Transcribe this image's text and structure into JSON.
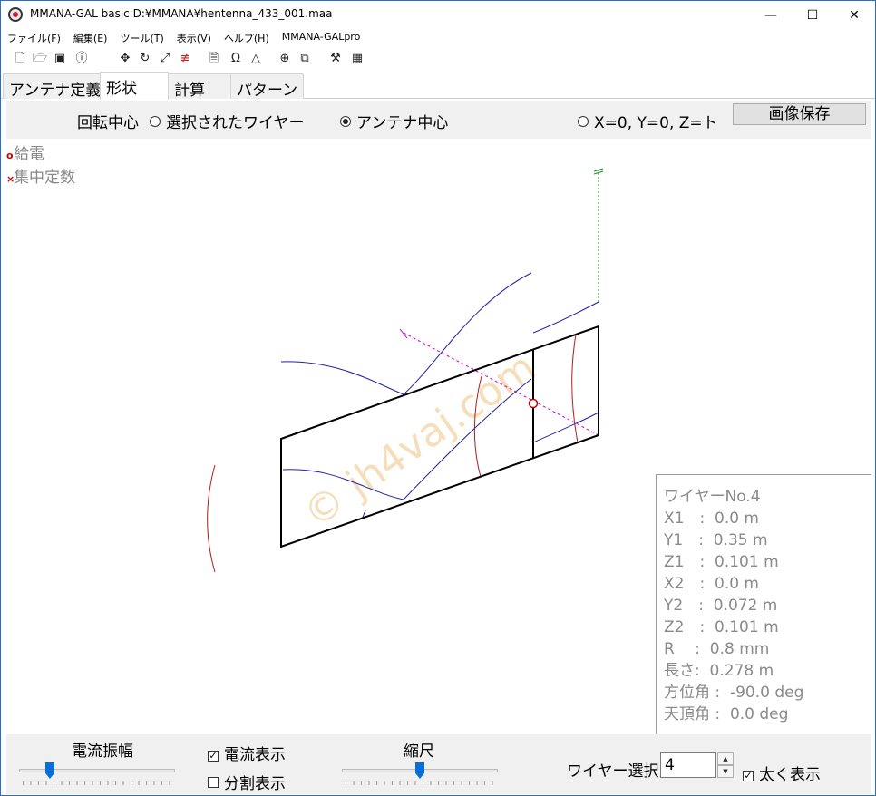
{
  "window": {
    "title": "MMANA-GAL basic  D:¥MMANA¥hentenna_433_001.maa",
    "controls": {
      "minimize": "—",
      "maximize": "☐",
      "close": "✕"
    }
  },
  "menu": [
    "ファイル(F)",
    "編集(E)",
    "ツール(T)",
    "表示(V)",
    "ヘルプ(H)",
    "MMANA-GALpro"
  ],
  "toolbar_icons": [
    "new-file-icon",
    "open-folder-icon",
    "save-icon",
    "info-icon",
    "move-icon",
    "rotate-icon",
    "resize-icon",
    "wire-edit-icon",
    "document-icon",
    "omega-icon",
    "triangle-icon",
    "crosshair-icon",
    "copy-icon",
    "tools-icon",
    "calculator-icon"
  ],
  "tabs": [
    {
      "label": "アンテナ定義",
      "active": false
    },
    {
      "label": "形状",
      "active": true
    },
    {
      "label": "計算",
      "active": false
    },
    {
      "label": "パターン",
      "active": false
    }
  ],
  "options": {
    "rotation_center_label": "回転中心",
    "radio_selected_wire": "選択されたワイヤー",
    "radio_antenna_center": "アンテナ中心",
    "radio_origin": "X=0, Y=0, Z=ト",
    "selected": "antenna_center",
    "save_image_button": "画像保存"
  },
  "legend": {
    "feed": {
      "mark": "o",
      "label": "給電",
      "color": "#cc0000"
    },
    "lumped": {
      "mark": "×",
      "label": "集中定数",
      "color": "#cc0000"
    }
  },
  "watermark": "© jh4vaj.com",
  "wire_info": [
    "ワイヤーNo.4",
    "X1　:  0.0 m",
    "Y1　:  0.35 m",
    "Z1　:  0.101 m",
    "X2　:  0.0 m",
    "Y2　:  0.072 m",
    "Z2　:  0.101 m",
    "R　 :  0.8 mm",
    "長さ:  0.278 m",
    "方位角 :  -90.0 deg",
    "天頂角 :  0.0 deg"
  ],
  "bottom": {
    "current_amplitude_label": "電流振幅",
    "current_amplitude_level": 0.18,
    "show_current_label": "電流表示",
    "show_current_checked": true,
    "show_segments_label": "分割表示",
    "show_segments_checked": false,
    "scale_label": "縮尺",
    "scale_level": 0.5,
    "wire_select_label": "ワイヤー選択",
    "wire_select_value": "4",
    "bold_display_label": "太く表示",
    "bold_display_checked": true
  },
  "colors": {
    "wire": "#000000",
    "current_blue": "#1f1fa8",
    "current_red": "#b41a1a",
    "axis_magenta": "#cc00cc",
    "axis_green": "#1a8a1a",
    "watermark": "#f3d6a8",
    "accent": "#0a6fd4"
  }
}
